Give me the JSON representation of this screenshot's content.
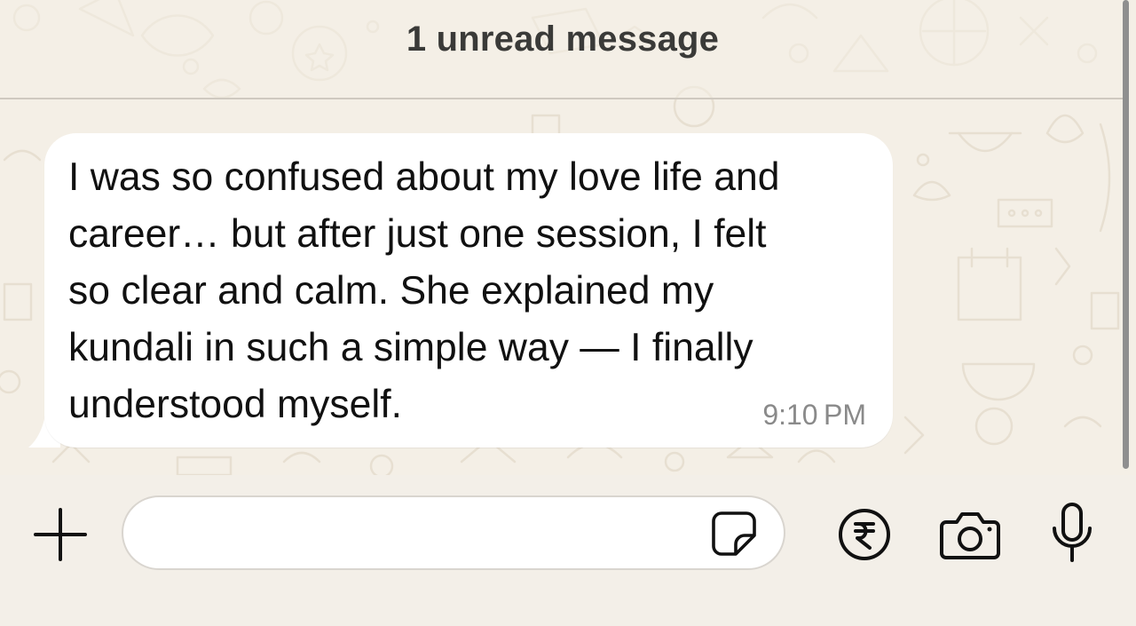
{
  "unread_banner": {
    "text": "1 unread message"
  },
  "message": {
    "direction": "incoming",
    "lines": [
      "I was so confused about my love life and",
      "career… but after just one session, I felt",
      "so clear and calm. She explained my",
      "kundali in such a simple way — I finally",
      "understood myself."
    ],
    "time": "9:10 PM"
  },
  "composer": {
    "value": "",
    "icons": {
      "attach": "plus-icon",
      "sticker": "sticker-icon",
      "payment": "rupee-icon",
      "camera": "camera-icon",
      "voice": "microphone-icon"
    }
  },
  "colors": {
    "wallpaper": "#f4efe6",
    "bubble": "#ffffff",
    "text": "#111111",
    "timestamp": "#8a8a8a",
    "icon": "#111111"
  }
}
